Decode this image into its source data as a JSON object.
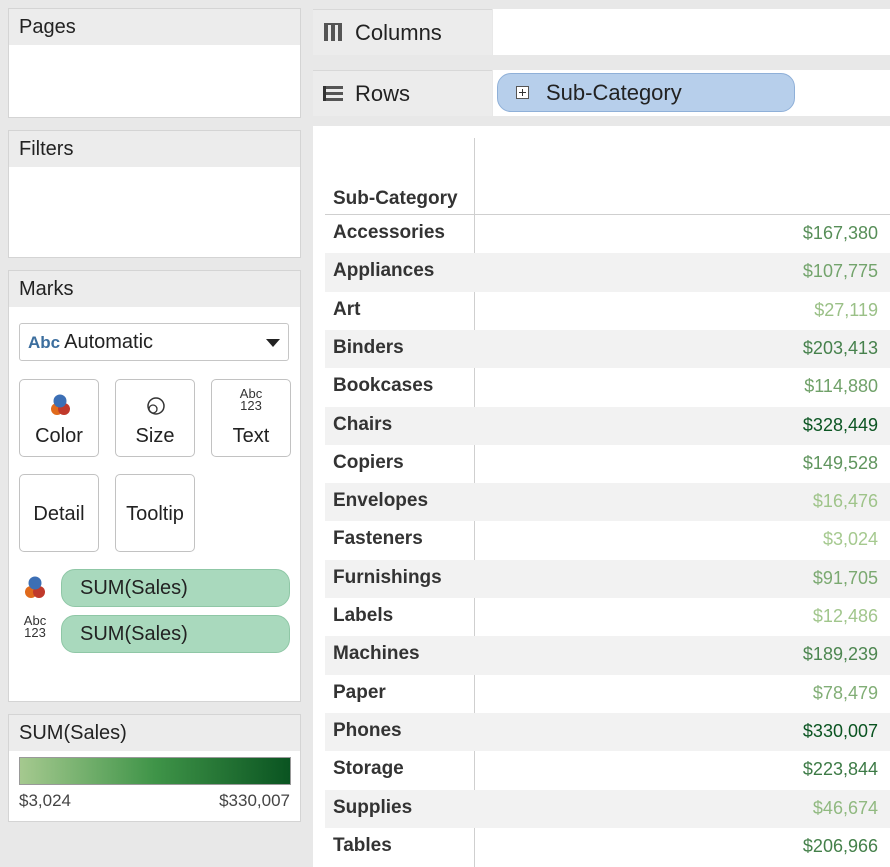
{
  "left": {
    "pages_title": "Pages",
    "filters_title": "Filters",
    "marks_title": "Marks",
    "mark_type_abc": "Abc",
    "mark_type": "Automatic",
    "buttons": {
      "color": "Color",
      "size": "Size",
      "text": "Text",
      "text_icon_top": "Abc",
      "text_icon_bottom": "123",
      "detail": "Detail",
      "tooltip": "Tooltip"
    },
    "mark_pills": [
      "SUM(Sales)",
      "SUM(Sales)"
    ],
    "legend": {
      "title": "SUM(Sales)",
      "min": "$3,024",
      "max": "$330,007",
      "color_min": "#a5c98f",
      "color_max": "#0a5421"
    }
  },
  "shelves": {
    "columns_label": "Columns",
    "rows_label": "Rows",
    "rows_pill": "Sub-Category"
  },
  "table": {
    "header": "Sub-Category",
    "rows": [
      {
        "name": "Accessories",
        "value": "$167,380",
        "amount": 167380
      },
      {
        "name": "Appliances",
        "value": "$107,775",
        "amount": 107775
      },
      {
        "name": "Art",
        "value": "$27,119",
        "amount": 27119
      },
      {
        "name": "Binders",
        "value": "$203,413",
        "amount": 203413
      },
      {
        "name": "Bookcases",
        "value": "$114,880",
        "amount": 114880
      },
      {
        "name": "Chairs",
        "value": "$328,449",
        "amount": 328449
      },
      {
        "name": "Copiers",
        "value": "$149,528",
        "amount": 149528
      },
      {
        "name": "Envelopes",
        "value": "$16,476",
        "amount": 16476
      },
      {
        "name": "Fasteners",
        "value": "$3,024",
        "amount": 3024
      },
      {
        "name": "Furnishings",
        "value": "$91,705",
        "amount": 91705
      },
      {
        "name": "Labels",
        "value": "$12,486",
        "amount": 12486
      },
      {
        "name": "Machines",
        "value": "$189,239",
        "amount": 189239
      },
      {
        "name": "Paper",
        "value": "$78,479",
        "amount": 78479
      },
      {
        "name": "Phones",
        "value": "$330,007",
        "amount": 330007
      },
      {
        "name": "Storage",
        "value": "$223,844",
        "amount": 223844
      },
      {
        "name": "Supplies",
        "value": "$46,674",
        "amount": 46674
      },
      {
        "name": "Tables",
        "value": "$206,966",
        "amount": 206966
      }
    ]
  }
}
